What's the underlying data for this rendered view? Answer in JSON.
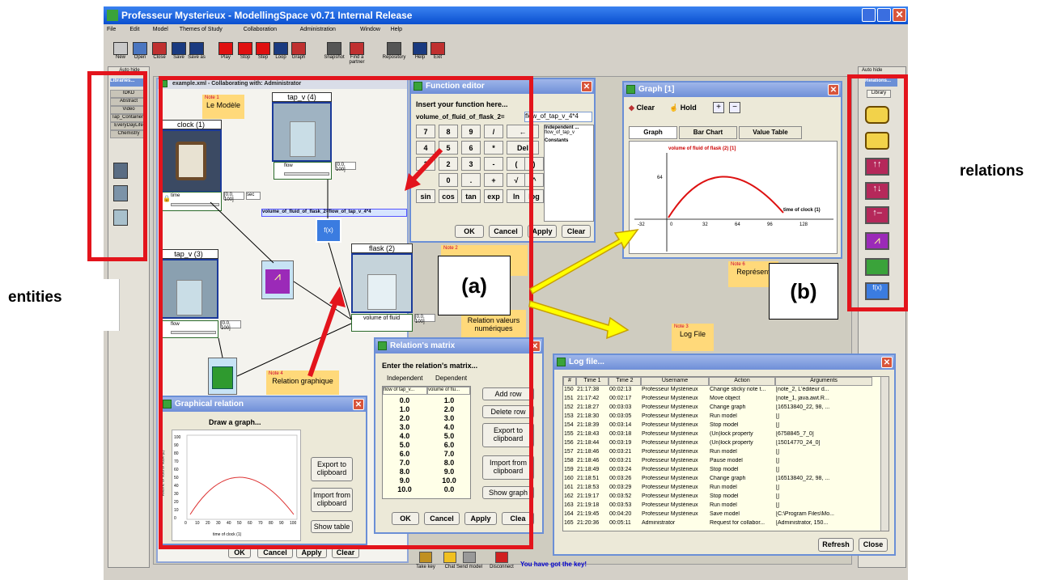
{
  "app": {
    "title": "Professeur Mysterieux - ModellingSpace v0.71 Internal Release"
  },
  "menu": [
    "File",
    "Edit",
    "Model",
    "Themes of Study",
    "Collaboration",
    "Administration",
    "Window",
    "Help"
  ],
  "toolbar": [
    "New",
    "Open",
    "Close",
    "Save",
    "Save as",
    "Play",
    "Stop",
    "Step",
    "Loop",
    "Graph",
    "Snapshot",
    "Find a partner",
    "Repository",
    "Help",
    "Exit"
  ],
  "left_panel": {
    "autohide": "Auto hide",
    "header": "Libraries...",
    "tabs": [
      "IDKD",
      "Abstract",
      "Video",
      "Tap_Containers",
      "EveryDayLife",
      "Chemistry"
    ]
  },
  "right_panel": {
    "autohide": "Auto hide",
    "header": "Relations...",
    "tab": "Library"
  },
  "model_window": {
    "title": "example.xml - Collaborating with: Administrator"
  },
  "entities": {
    "clock": "clock (1)",
    "tap4": "tap_v (4)",
    "tap3": "tap_v (3)",
    "flask": "flask (2)",
    "time": "time",
    "flow": "flow",
    "flow2": "flow",
    "volume": "volume of fluid",
    "range": "[0.0, 100]",
    "sec": "sec",
    "formula": "volume_of_fluid_of_flask_2=flow_of_tap_v_4*4"
  },
  "notes": {
    "n1_hd": "Note 1",
    "n1": "Le Modèle",
    "n2_hd": "Note 2",
    "n4_hd": "Note 4",
    "n4": "Relation graphique",
    "n5": "Relation valeurs numériques",
    "n6_hd": "Note 6",
    "n6": "Représent",
    "n3_hd": "Note 3",
    "n3": "Log File"
  },
  "function_editor": {
    "title": "Function editor",
    "prompt": "Insert your function here...",
    "lhs": "volume_of_fluid_of_flask_2=",
    "rhs": "flow_of_tap_v_4*4",
    "keys": [
      "7",
      "8",
      "9",
      "/",
      "←",
      "4",
      "5",
      "6",
      "*",
      "Del",
      "1",
      "2",
      "3",
      "-",
      "(",
      ")",
      "0",
      ".",
      "+",
      "√",
      "^",
      "sin",
      "cos",
      "tan",
      "exp",
      "ln",
      "log"
    ],
    "independent": "Independent ...",
    "indep_item": "flow_of_tap_v",
    "constants": "Constants",
    "ok": "OK",
    "cancel": "Cancel",
    "apply": "Apply",
    "clear": "Clear"
  },
  "graph_window": {
    "title": "Graph [1]",
    "clear": "Clear",
    "hold": "Hold",
    "tabs": [
      "Graph",
      "Bar Chart",
      "Value Table"
    ],
    "series": "volume of fluid of flask (2) [1]",
    "xlabel": "time of clock (1)",
    "xticks": [
      "-32",
      "0",
      "32",
      "64",
      "96",
      "128"
    ],
    "ytick": "64"
  },
  "relations_matrix": {
    "title": "Relation's matrix",
    "prompt": "Enter the relation's matrix...",
    "indep": "Independent",
    "dep": "Dependent",
    "col1": "flow of tap_v...",
    "col2": "volume of flu...",
    "rows": [
      [
        "0.0",
        "1.0"
      ],
      [
        "1.0",
        "2.0"
      ],
      [
        "2.0",
        "3.0"
      ],
      [
        "3.0",
        "4.0"
      ],
      [
        "4.0",
        "5.0"
      ],
      [
        "5.0",
        "6.0"
      ],
      [
        "6.0",
        "7.0"
      ],
      [
        "7.0",
        "8.0"
      ],
      [
        "8.0",
        "9.0"
      ],
      [
        "9.0",
        "10.0"
      ],
      [
        "10.0",
        "0.0"
      ]
    ],
    "add": "Add row",
    "del": "Delete row",
    "export": "Export to clipboard",
    "import": "Import from clipboard",
    "show": "Show graph",
    "ok": "OK",
    "cancel": "Cancel",
    "apply": "Apply",
    "clear": "Clea"
  },
  "graphical_relation": {
    "title": "Graphical relation",
    "heading": "Draw a graph...",
    "ylabel": "volume of fluid of flask (2)",
    "xlabel": "time of clock (1)",
    "xticks": [
      "0",
      "10",
      "20",
      "30",
      "40",
      "50",
      "60",
      "70",
      "80",
      "90",
      "100"
    ],
    "yticks": [
      "0",
      "10",
      "20",
      "30",
      "40",
      "50",
      "60",
      "70",
      "80",
      "90",
      "100"
    ],
    "export": "Export to clipboard",
    "import": "Import from clipboard",
    "show": "Show table",
    "ok": "OK",
    "cancel": "Cancel",
    "apply": "Apply",
    "clear": "Clear"
  },
  "log": {
    "title": "Log file...",
    "headers": [
      "#",
      "Time 1",
      "Time 2",
      "Username",
      "Action",
      "Arguments"
    ],
    "rows": [
      [
        "150",
        "21:17:38",
        "00:02:13",
        "Professeur Mystérieux",
        "Change sticky note t...",
        "[note_2, L'éditeur d..."
      ],
      [
        "151",
        "21:17:42",
        "00:02:17",
        "Professeur Mystérieux",
        "Move object",
        "[note_1, java.awt.R..."
      ],
      [
        "152",
        "21:18:27",
        "00:03:03",
        "Professeur Mystérieux",
        "Change graph",
        "[16513840_22, 98, ..."
      ],
      [
        "153",
        "21:18:30",
        "00:03:05",
        "Professeur Mystérieux",
        "Run model",
        "[]"
      ],
      [
        "154",
        "21:18:39",
        "00:03:14",
        "Professeur Mystérieux",
        "Stop model",
        "[]"
      ],
      [
        "155",
        "21:18:43",
        "00:03:18",
        "Professeur Mystérieux",
        "(Un)lock property",
        "[6758845_7_0]"
      ],
      [
        "156",
        "21:18:44",
        "00:03:19",
        "Professeur Mystérieux",
        "(Un)lock property",
        "[15014770_24_0]"
      ],
      [
        "157",
        "21:18:46",
        "00:03:21",
        "Professeur Mystérieux",
        "Run model",
        "[]"
      ],
      [
        "158",
        "21:18:46",
        "00:03:21",
        "Professeur Mystérieux",
        "Pause model",
        "[]"
      ],
      [
        "159",
        "21:18:49",
        "00:03:24",
        "Professeur Mystérieux",
        "Stop model",
        "[]"
      ],
      [
        "160",
        "21:18:51",
        "00:03:26",
        "Professeur Mystérieux",
        "Change graph",
        "[16513840_22, 98, ..."
      ],
      [
        "161",
        "21:18:53",
        "00:03:29",
        "Professeur Mystérieux",
        "Run model",
        "[]"
      ],
      [
        "162",
        "21:19:17",
        "00:03:52",
        "Professeur Mystérieux",
        "Stop model",
        "[]"
      ],
      [
        "163",
        "21:19:18",
        "00:03:53",
        "Professeur Mystérieux",
        "Run model",
        "[]"
      ],
      [
        "164",
        "21:19:45",
        "00:04:20",
        "Professeur Mystérieux",
        "Save model",
        "[C:\\Program Files\\Mo..."
      ],
      [
        "165",
        "21:20:36",
        "00:05:11",
        "Administrator",
        "Request for collabor...",
        "[Administrator, 150..."
      ]
    ],
    "refresh": "Refresh",
    "close": "Close"
  },
  "bottom": {
    "buttons": [
      "Take key",
      "Chat",
      "Send model",
      "Disconnect"
    ],
    "status": "You have got the key!",
    "ok": "OK",
    "cancel": "Cancel",
    "apply": "Apply",
    "clear": "Clear"
  },
  "annotations": {
    "entities": "entities",
    "relations": "relations",
    "a": "(a)",
    "b": "(b)"
  }
}
